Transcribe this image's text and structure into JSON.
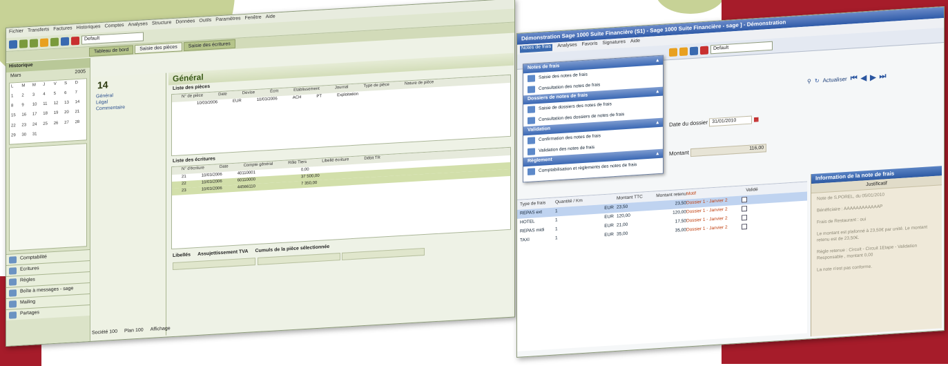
{
  "left_window": {
    "menu": [
      "Fichier",
      "Transferts",
      "Factures",
      "Historiques",
      "Comptes",
      "Analyses",
      "Structure",
      "Données",
      "Outils",
      "Paramètres",
      "Fenêtre",
      "Aide"
    ],
    "combo_value": "Default",
    "tabs": [
      "Tableau de bord",
      "Saisie des pièces",
      "Saisie des écritures"
    ],
    "nav_header": "Historique",
    "month": "Mars",
    "year": "2005",
    "nav_items": [
      "Comptabilité",
      "Ecritures",
      "Règles",
      "Boîte à messages - sage",
      "Mailing",
      "Partages"
    ],
    "org_number": "14",
    "org_items": [
      "Général",
      "Légal",
      "Commentaire"
    ],
    "section_title": "Général",
    "pieces_header": "Liste des pièces",
    "pieces_cols": [
      "N° de pièce",
      "Date",
      "Devise",
      "Écrit",
      "Etablissement",
      "Journal",
      "Type de pièce",
      "Nature de pièce"
    ],
    "pieces_row": [
      "",
      "10/03/2006",
      "EUR",
      "10/03/2006",
      "ACH",
      "PT",
      "Exploitation"
    ],
    "ecritures_header": "Liste des écritures",
    "ecritures_cols": [
      "N° d'écriture",
      "Date",
      "Compte général",
      "Rôle Tiers",
      "Libellé écriture",
      "Débit TR"
    ],
    "ecritures_rows": [
      [
        "21",
        "10/03/2006",
        "40110001",
        "",
        "",
        "0,00"
      ],
      [
        "22",
        "10/03/2006",
        "60110000",
        "",
        "",
        "37 500,00"
      ],
      [
        "23",
        "10/03/2006",
        "44566110",
        "",
        "",
        "7 350,00"
      ]
    ],
    "bottom_labels": {
      "cumul": "Cumuls de la pièce sélectionnée",
      "tva": "Assujettissement TVA",
      "libelles": "Libellés"
    },
    "status_tabs": [
      "Société 100",
      "Plan 100",
      "Affichage"
    ]
  },
  "right_window": {
    "title": "Démonstration Sage 1000 Suite Financière (S1) - Sage 1000 Suite Financière - sage ] - Démonstration",
    "menu": [
      "Notes de frais",
      "Analyses",
      "Favoris",
      "Signatures",
      "Aide"
    ],
    "combo_value": "Default",
    "dropdown": [
      {
        "section": "Notes de frais",
        "items": [
          "Saisie des notes de frais",
          "Consultation des notes de frais"
        ]
      },
      {
        "section": "Dossiers de notes de frais",
        "items": [
          "Saisie de dossiers des notes de frais",
          "Consultation des dossiers de notes de frais"
        ]
      },
      {
        "section": "Validation",
        "items": [
          "Confirmation des notes de frais",
          "Validation des notes de frais"
        ]
      },
      {
        "section": "Règlement",
        "items": [
          "Comptabilisation et règlements des notes de frais"
        ]
      }
    ],
    "actualiser": "Actualiser",
    "date_label": "Date du dossier",
    "date_value": "31/01/2010",
    "montant_label": "Montant",
    "montant_value": "116,00",
    "table_cols": [
      "Type de frais",
      "Quantité / Km",
      "",
      "Montant TTC",
      "Montant retenu",
      "Motif",
      "Validé"
    ],
    "table_rows": [
      {
        "type": "REPAS ext",
        "qte": "1",
        "dev": "EUR",
        "ttc": "23,50",
        "ret": "23,50",
        "motif": "Dossier 1 - Janvier 2",
        "sel": true
      },
      {
        "type": "HOTEL",
        "qte": "1",
        "dev": "EUR",
        "ttc": "120,00",
        "ret": "120,00",
        "motif": "Dossier 1 - Janvier 2",
        "sel": false
      },
      {
        "type": "REPAS midi",
        "qte": "1",
        "dev": "EUR",
        "ttc": "21,00",
        "ret": "17,50",
        "motif": "Dossier 1 - Janvier 2",
        "sel": false
      },
      {
        "type": "TAXI",
        "qte": "1",
        "dev": "EUR",
        "ttc": "35,00",
        "ret": "35,00",
        "motif": "Dossier 1 - Janvier 2",
        "sel": false
      }
    ],
    "info_title": "Information de la note de frais",
    "info_sub": "Justificatif",
    "info_lines": [
      "Note de S.POREL, du 05/01/2010",
      "Bénéficiaire : AAAAAAAAAAAAP",
      "Frais de Restaurant : oui",
      "Le montant est plafonné à 23,50€ par unité. Le montant retenu est de 23,50€.",
      "Règle retenue : Circuit - Circuit 1Etape - Validation Responsable , montant 0,00",
      "La note n'est pas conforme."
    ]
  }
}
